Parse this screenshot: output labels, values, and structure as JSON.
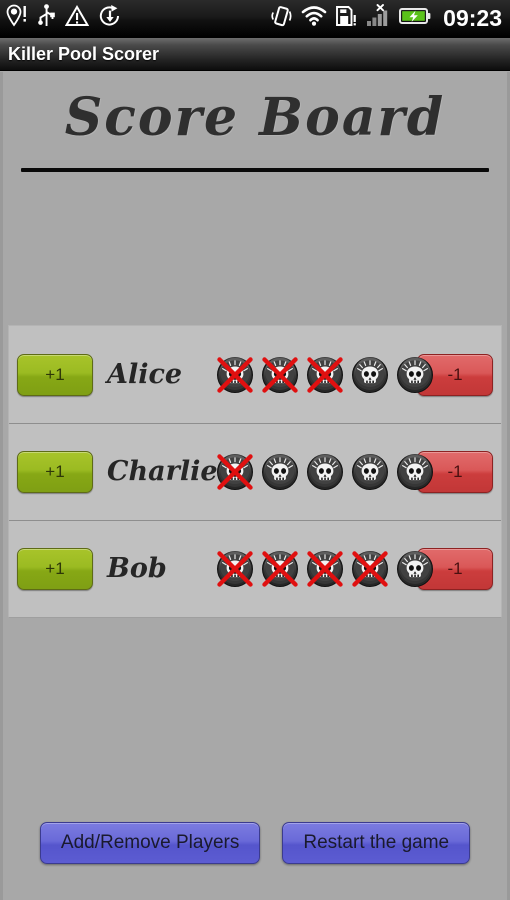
{
  "statusbar": {
    "time": "09:23",
    "left_icons": [
      {
        "name": "location-alert-icon",
        "label": "GPS location"
      },
      {
        "name": "usb-icon",
        "label": "USB connected"
      },
      {
        "name": "warning-triangle-icon",
        "label": "Warning"
      },
      {
        "name": "download-sync-icon",
        "label": "Downloading"
      }
    ],
    "right_icons": [
      {
        "name": "vibrate-icon",
        "label": "Vibrate mode"
      },
      {
        "name": "wifi-icon",
        "label": "Wi-Fi connected"
      },
      {
        "name": "sdcard-alert-icon",
        "label": "SD card"
      },
      {
        "name": "signal-bars-no-service-icon",
        "label": "No service"
      },
      {
        "name": "battery-charging-icon",
        "label": "Charging"
      }
    ]
  },
  "app": {
    "title": "Killer Pool Scorer",
    "board_title": "Score Board"
  },
  "colors": {
    "page_background": "#a8a8a8",
    "list_background": "#c0c0c0",
    "plus_button": "#9bbb22",
    "minus_button": "#cc3d3d",
    "action_button": "#6a6ad8",
    "cross_red": "#e01010",
    "title_text": "#2f2f2f"
  },
  "players": [
    {
      "name": "Alice",
      "plus_label": "+1",
      "minus_label": "-1",
      "total_lives": 5,
      "lives_lost": 3,
      "lives_remaining": 2,
      "life_states": [
        "lost",
        "lost",
        "lost",
        "alive",
        "alive"
      ]
    },
    {
      "name": "Charlie",
      "plus_label": "+1",
      "minus_label": "-1",
      "total_lives": 5,
      "lives_lost": 1,
      "lives_remaining": 4,
      "life_states": [
        "lost",
        "alive",
        "alive",
        "alive",
        "alive"
      ]
    },
    {
      "name": "Bob",
      "plus_label": "+1",
      "minus_label": "-1",
      "total_lives": 5,
      "lives_lost": 4,
      "lives_remaining": 1,
      "life_states": [
        "lost",
        "lost",
        "lost",
        "lost",
        "alive"
      ]
    }
  ],
  "bottom_buttons": [
    {
      "name": "add-remove-players-button",
      "label": "Add/Remove Players"
    },
    {
      "name": "restart-game-button",
      "label": "Restart the game"
    }
  ]
}
